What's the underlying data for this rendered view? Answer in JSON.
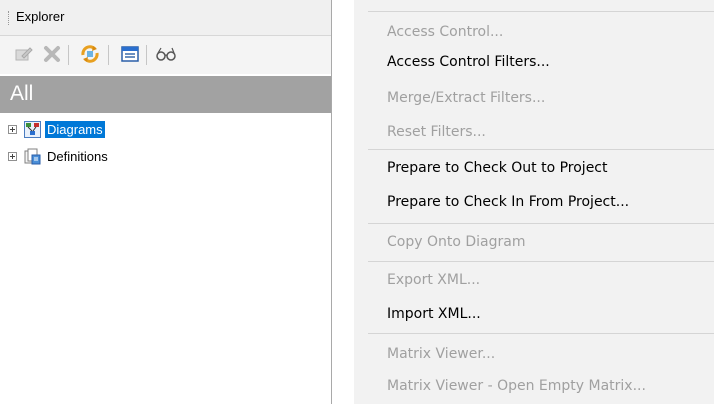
{
  "explorer": {
    "title": "Explorer",
    "scope": "All",
    "toolbar": {
      "icons": [
        "edit-icon",
        "delete-icon",
        "refresh-icon",
        "window-icon",
        "glasses-icon"
      ]
    },
    "tree": [
      {
        "label": "Diagrams",
        "icon": "diagram-icon",
        "selected": true
      },
      {
        "label": "Definitions",
        "icon": "definitions-icon",
        "selected": false
      }
    ]
  },
  "menu": {
    "items": [
      {
        "label": "Access Control...",
        "enabled": false
      },
      {
        "label": "Access Control Filters...",
        "enabled": true
      },
      {
        "label": "Merge/Extract Filters...",
        "enabled": false
      },
      {
        "label": "Reset Filters...",
        "enabled": false
      },
      {
        "label": "Prepare to Check Out to Project",
        "enabled": true
      },
      {
        "label": "Prepare to Check In From Project...",
        "enabled": true
      },
      {
        "label": "Copy Onto Diagram",
        "enabled": false
      },
      {
        "label": "Export XML...",
        "enabled": false
      },
      {
        "label": "Import XML...",
        "enabled": true
      },
      {
        "label": "Matrix Viewer...",
        "enabled": false
      },
      {
        "label": "Matrix Viewer - Open Empty Matrix...",
        "enabled": false
      }
    ]
  },
  "colors": {
    "selection": "#0078d7",
    "scope_bar": "#a2a2a2",
    "menu_bg": "#f2f2f2",
    "disabled_text": "#a0a0a0"
  }
}
